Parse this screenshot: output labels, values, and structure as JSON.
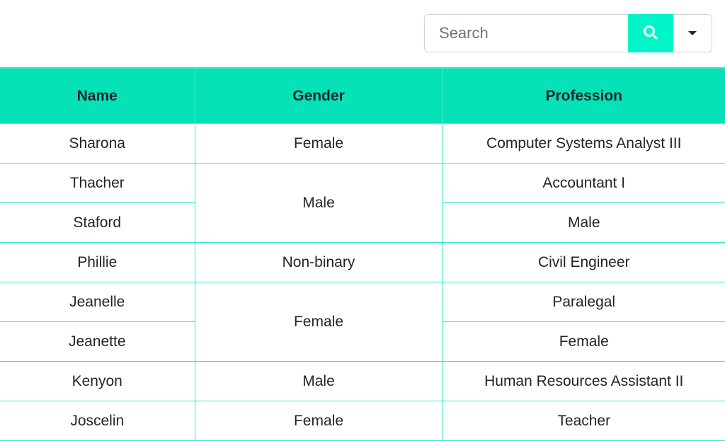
{
  "toolbar": {
    "search_placeholder": "Search",
    "search_icon": "search-icon",
    "dropdown_icon": "caret-down-icon",
    "accent_color": "#06e2b8"
  },
  "table": {
    "headers": [
      "Name",
      "Gender",
      "Profession"
    ],
    "rows": [
      {
        "name": "Sharona",
        "gender": "Female",
        "profession": "Computer Systems Analyst III"
      },
      {
        "name": "Thacher",
        "gender": "Male",
        "profession": "Accountant I"
      },
      {
        "name": "Staford",
        "gender": "Male",
        "profession": "Male"
      },
      {
        "name": "Phillie",
        "gender": "Non-binary",
        "profession": "Civil Engineer"
      },
      {
        "name": "Jeanelle",
        "gender": "Female",
        "profession": "Paralegal"
      },
      {
        "name": "Jeanette",
        "gender": "Female",
        "profession": "Female"
      },
      {
        "name": "Kenyon",
        "gender": "Male",
        "profession": "Human Resources Assistant II"
      },
      {
        "name": "Joscelin",
        "gender": "Female",
        "profession": "Teacher"
      }
    ]
  }
}
